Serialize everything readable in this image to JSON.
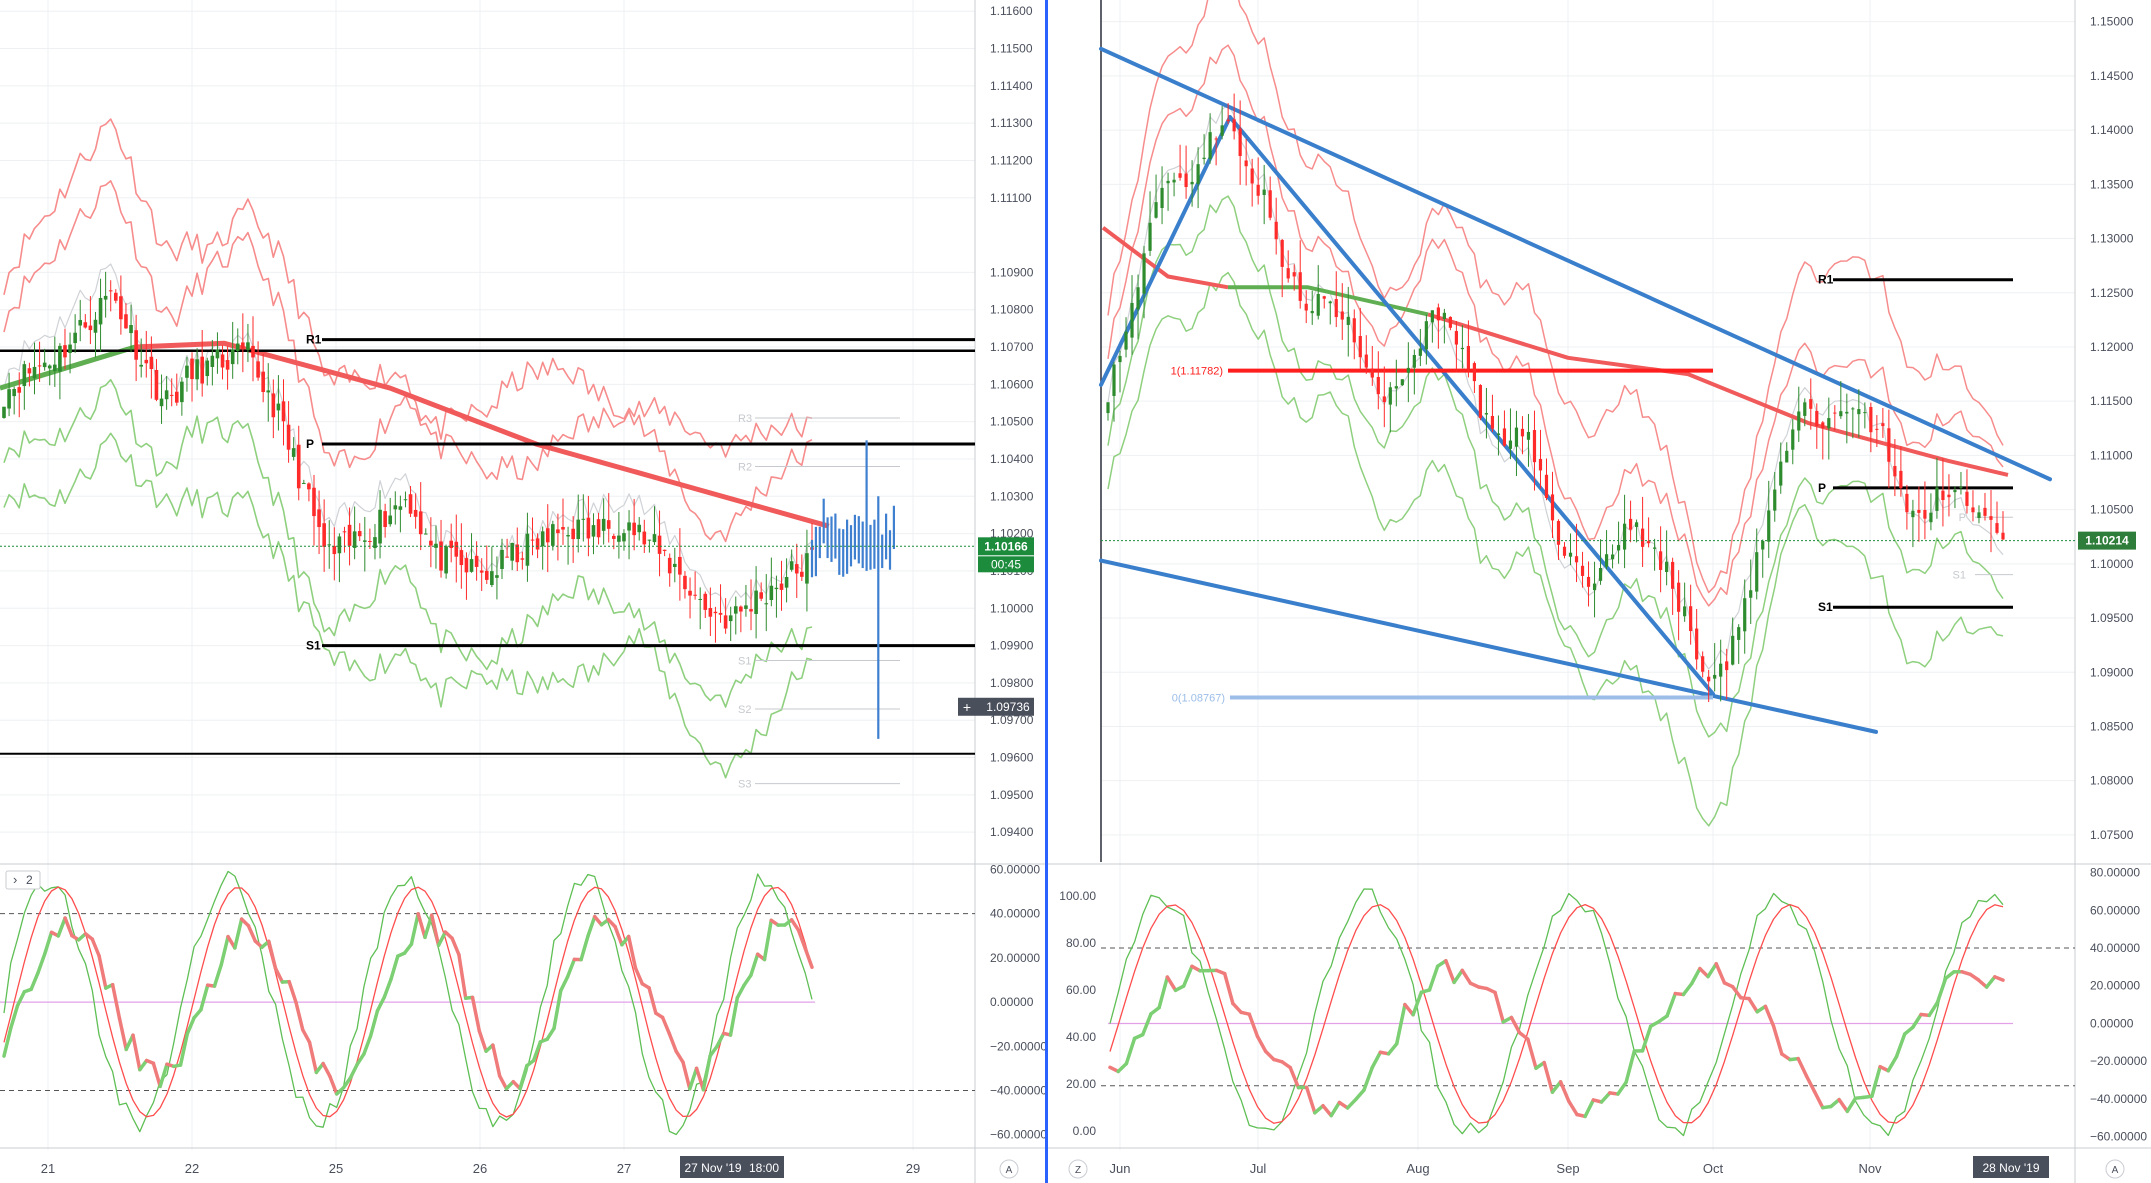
{
  "colors": {
    "grid": "#eef0f3",
    "axis_text": "#4a4f5c",
    "divider": "#2962ff",
    "candle_up": "#2e8b2e",
    "candle_down": "#ff2a2a",
    "forecast": "#3f7fd0",
    "ma": "#f05a5a",
    "ma_green": "#5fae52",
    "band_red": "#f78c8c",
    "band_green": "#8fd07f",
    "mid": "#cfd2d6",
    "trend": "#3a7fcc",
    "fib": "#9bbde8",
    "fib_red": "#ff1e1e",
    "pivot_faint": "#c6c9ce",
    "osc_fast": "#5fbf55",
    "osc_slow": "#ff4d4d",
    "osc_up": "#7ccf72",
    "osc_down": "#f07b7b",
    "osc_zero": "#e2a0e8",
    "current_price_bg": "#1c8b3c",
    "crosshair_bg": "#4a4f5c"
  },
  "left_chart": {
    "price_axis": [
      "1.11600",
      "1.11500",
      "1.11400",
      "1.11300",
      "1.11200",
      "1.11100",
      "1.10900",
      "1.10800",
      "1.10700",
      "1.10600",
      "1.10500",
      "1.10400",
      "1.10300",
      "1.10200",
      "1.10100",
      "1.10000",
      "1.09900",
      "1.09800",
      "1.09700",
      "1.09600",
      "1.09500",
      "1.09400"
    ],
    "price_range": [
      1.0932,
      1.1163
    ],
    "current_price": "1.10166",
    "countdown": "00:45",
    "crosshair_price": "1.09736",
    "pivots": [
      {
        "label": "R1",
        "value": 1.1072,
        "strong": true
      },
      {
        "label": "P",
        "value": 1.1044,
        "strong": true
      },
      {
        "label": "S1",
        "value": 1.099,
        "strong": true
      },
      {
        "label": "R3",
        "value": 1.1051,
        "strong": false
      },
      {
        "label": "R2",
        "value": 1.1038,
        "strong": false
      },
      {
        "label": "S1",
        "value": 1.0986,
        "strong": false
      },
      {
        "label": "S2",
        "value": 1.0973,
        "strong": false
      },
      {
        "label": "S3",
        "value": 1.0953,
        "strong": false
      }
    ],
    "support_line": 1.0961,
    "date_axis": [
      "21",
      "22",
      "25",
      "26",
      "27",
      "29"
    ],
    "date_label": "27 Nov '19",
    "time_label": "18:00",
    "osc_axis": [
      "60.00000",
      "40.00000",
      "20.00000",
      "0.00000",
      "−20.00000",
      "−40.00000",
      "−60.00000"
    ],
    "osc_range": [
      -66,
      62
    ],
    "indicator_tag": "2",
    "scale_mode": "A"
  },
  "right_chart": {
    "price_axis": [
      "1.15000",
      "1.14500",
      "1.14000",
      "1.13500",
      "1.13000",
      "1.12500",
      "1.12000",
      "1.11500",
      "1.11000",
      "1.10500",
      "1.10000",
      "1.09500",
      "1.09000",
      "1.08500",
      "1.08000",
      "1.07500"
    ],
    "price_range": [
      1.0725,
      1.152
    ],
    "current_price": "1.10214",
    "fib_labels": [
      {
        "label": "1(1.11782)",
        "value": 1.11782
      },
      {
        "label": "0(1.08767)",
        "value": 1.08767
      }
    ],
    "pivots": [
      {
        "label": "R1",
        "value": 1.1262,
        "strong": true
      },
      {
        "label": "P",
        "value": 1.107,
        "strong": true
      },
      {
        "label": "S1",
        "value": 1.096,
        "strong": true
      },
      {
        "label": "P",
        "value": 1.1043,
        "strong": false
      },
      {
        "label": "S1",
        "value": 1.099,
        "strong": false
      }
    ],
    "date_axis": [
      "Jun",
      "Jul",
      "Aug",
      "Sep",
      "Oct",
      "Nov"
    ],
    "date_label": "28 Nov '19",
    "osc_axis_right": [
      "80.00000",
      "60.00000",
      "40.00000",
      "20.00000",
      "0.00000",
      "−20.00000",
      "−40.00000",
      "−60.00000"
    ],
    "osc_axis_left": [
      "100.00",
      "80.00",
      "60.00",
      "40.00",
      "20.00",
      "0.00"
    ],
    "osc_range": [
      -66,
      84
    ],
    "scale_mode": "A",
    "zoom_label": "Z"
  },
  "chart_data": [
    {
      "type": "candlestick",
      "title": "",
      "xlabel": "",
      "ylabel": "",
      "x_ticks": [
        "21",
        "22",
        "25",
        "26",
        "27",
        "29"
      ],
      "ylim": [
        1.0932,
        1.1163
      ],
      "segments": [
        {
          "from": "21",
          "open": 1.1058,
          "trend": [
            1.1064,
            1.1068,
            1.1076,
            1.1085,
            1.1069,
            1.1055,
            1.1063,
            1.1066,
            1.1068,
            1.1055,
            1.1035,
            1.1014,
            1.1018,
            1.1024,
            1.103,
            1.1014,
            1.1011,
            1.1009,
            1.1015,
            1.1018,
            1.1022,
            1.102,
            1.1024,
            1.1017,
            1.101,
            1.1,
            1.0997,
            1.1003,
            1.1008,
            1.1013
          ]
        }
      ],
      "moving_average": [
        [
          0,
          1.1059
        ],
        [
          0.1,
          1.107
        ],
        [
          0.23,
          1.1071
        ],
        [
          0.4,
          1.1059
        ],
        [
          0.55,
          1.1044
        ],
        [
          0.7,
          1.1033
        ],
        [
          0.85,
          1.1022
        ]
      ],
      "forecast_range": [
        1.0965,
        1.1045
      ]
    },
    {
      "type": "candlestick",
      "title": "",
      "xlabel": "",
      "ylabel": "",
      "x_ticks": [
        "Jun",
        "Jul",
        "Aug",
        "Sep",
        "Oct",
        "Nov"
      ],
      "ylim": [
        1.0725,
        1.152
      ],
      "fib_levels": [
        1.11782,
        1.08767
      ],
      "trend": [
        1.116,
        1.122,
        1.13,
        1.136,
        1.135,
        1.139,
        1.141,
        1.137,
        1.133,
        1.127,
        1.123,
        1.125,
        1.122,
        1.119,
        1.115,
        1.118,
        1.122,
        1.124,
        1.118,
        1.113,
        1.11,
        1.113,
        1.106,
        1.101,
        1.098,
        1.1,
        1.104,
        1.102,
        1.1,
        1.095,
        1.09,
        1.09,
        1.096,
        1.103,
        1.11,
        1.115,
        1.112,
        1.115,
        1.113,
        1.112,
        1.106,
        1.104,
        1.107,
        1.106,
        1.104,
        1.1025
      ]
    }
  ]
}
